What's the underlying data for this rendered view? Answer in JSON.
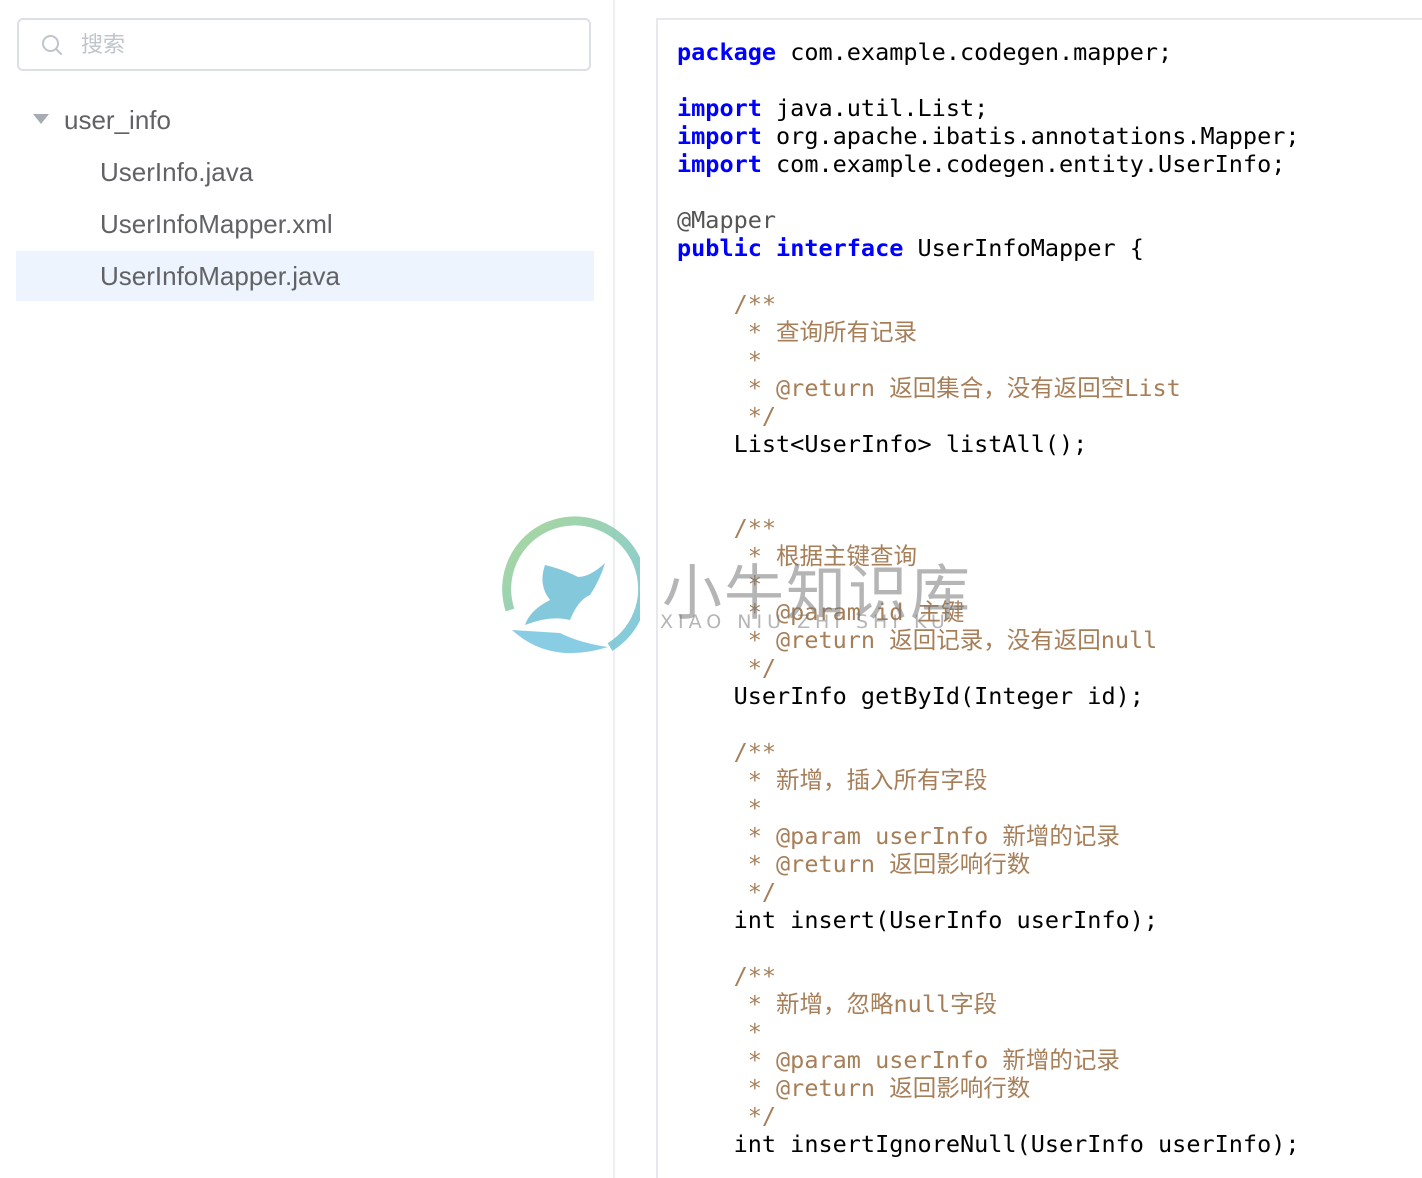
{
  "search": {
    "placeholder": "搜索",
    "icon": "search-icon"
  },
  "tree": {
    "folder": {
      "label": "user_info",
      "expanded": true,
      "icon": "caret-down-icon"
    },
    "files": [
      {
        "label": "UserInfo.java",
        "selected": false
      },
      {
        "label": "UserInfoMapper.xml",
        "selected": false
      },
      {
        "label": "UserInfoMapper.java",
        "selected": true
      }
    ]
  },
  "code": {
    "lines": [
      [
        [
          "kw",
          "package"
        ],
        [
          "p",
          " com.example.codegen.mapper;"
        ]
      ],
      [],
      [
        [
          "kw",
          "import"
        ],
        [
          "p",
          " java.util.List;"
        ]
      ],
      [
        [
          "kw",
          "import"
        ],
        [
          "p",
          " org.apache.ibatis.annotations.Mapper;"
        ]
      ],
      [
        [
          "kw",
          "import"
        ],
        [
          "p",
          " com.example.codegen.entity.UserInfo;"
        ]
      ],
      [],
      [
        [
          "an",
          "@Mapper"
        ]
      ],
      [
        [
          "kw",
          "public"
        ],
        [
          "p",
          " "
        ],
        [
          "kw",
          "interface"
        ],
        [
          "p",
          " UserInfoMapper {"
        ]
      ],
      [],
      [
        [
          "p",
          "    "
        ],
        [
          "cm",
          "/**"
        ]
      ],
      [
        [
          "p",
          "    "
        ],
        [
          "cm",
          " * 查询所有记录"
        ]
      ],
      [
        [
          "p",
          "    "
        ],
        [
          "cm",
          " *"
        ]
      ],
      [
        [
          "p",
          "    "
        ],
        [
          "cm",
          " * @return 返回集合，没有返回空List"
        ]
      ],
      [
        [
          "p",
          "    "
        ],
        [
          "cm",
          " */"
        ]
      ],
      [
        [
          "p",
          "    List<UserInfo> listAll();"
        ]
      ],
      [],
      [],
      [
        [
          "p",
          "    "
        ],
        [
          "cm",
          "/**"
        ]
      ],
      [
        [
          "p",
          "    "
        ],
        [
          "cm",
          " * 根据主键查询"
        ]
      ],
      [
        [
          "p",
          "    "
        ],
        [
          "cm",
          " *"
        ]
      ],
      [
        [
          "p",
          "    "
        ],
        [
          "cm",
          " * @param id 主键"
        ]
      ],
      [
        [
          "p",
          "    "
        ],
        [
          "cm",
          " * @return 返回记录，没有返回null"
        ]
      ],
      [
        [
          "p",
          "    "
        ],
        [
          "cm",
          " */"
        ]
      ],
      [
        [
          "p",
          "    UserInfo getById(Integer id);"
        ]
      ],
      [],
      [
        [
          "p",
          "    "
        ],
        [
          "cm",
          "/**"
        ]
      ],
      [
        [
          "p",
          "    "
        ],
        [
          "cm",
          " * 新增，插入所有字段"
        ]
      ],
      [
        [
          "p",
          "    "
        ],
        [
          "cm",
          " *"
        ]
      ],
      [
        [
          "p",
          "    "
        ],
        [
          "cm",
          " * @param userInfo 新增的记录"
        ]
      ],
      [
        [
          "p",
          "    "
        ],
        [
          "cm",
          " * @return 返回影响行数"
        ]
      ],
      [
        [
          "p",
          "    "
        ],
        [
          "cm",
          " */"
        ]
      ],
      [
        [
          "p",
          "    int insert(UserInfo userInfo);"
        ]
      ],
      [],
      [
        [
          "p",
          "    "
        ],
        [
          "cm",
          "/**"
        ]
      ],
      [
        [
          "p",
          "    "
        ],
        [
          "cm",
          " * 新增，忽略null字段"
        ]
      ],
      [
        [
          "p",
          "    "
        ],
        [
          "cm",
          " *"
        ]
      ],
      [
        [
          "p",
          "    "
        ],
        [
          "cm",
          " * @param userInfo 新增的记录"
        ]
      ],
      [
        [
          "p",
          "    "
        ],
        [
          "cm",
          " * @return 返回影响行数"
        ]
      ],
      [
        [
          "p",
          "    "
        ],
        [
          "cm",
          " */"
        ]
      ],
      [
        [
          "p",
          "    int insertIgnoreNull(UserInfo userInfo);"
        ]
      ]
    ],
    "colors": {
      "keyword": "#0000ff",
      "comment": "#a67f59",
      "annotation": "#555555",
      "plain": "#000000"
    }
  },
  "watermark": {
    "title": "小牛知识库",
    "subtitle": "XIAO NIU ZHI SHI KU"
  },
  "colors": {
    "selected_row": "#eef4fd",
    "border": "#dcdfe6",
    "tree_text": "#606266"
  }
}
